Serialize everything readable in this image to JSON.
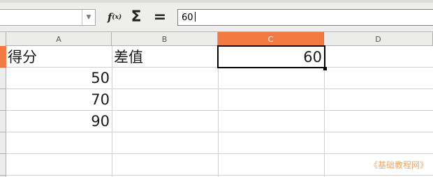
{
  "toolbar": {
    "namebox_value": "",
    "namebox_arrow": "▼",
    "function_wizard_label": "f",
    "function_wizard_sub": "(x)",
    "sum_label": "Σ",
    "formula_label": "=",
    "formula_value": "60"
  },
  "columns": [
    {
      "label": "A",
      "active": false
    },
    {
      "label": "B",
      "active": false
    },
    {
      "label": "C",
      "active": true
    },
    {
      "label": "D",
      "active": false
    }
  ],
  "cells": {
    "A1": "得分",
    "B1": "差值",
    "C1": "60",
    "A2": "50",
    "A3": "70",
    "A4": "90"
  },
  "selected_cell": "C1",
  "watermark": "《基础教程网》",
  "colors": {
    "accent": "#f37b43",
    "toolbar_bg": "#eeeeec",
    "header_bg": "#ececea",
    "watermark": "#f0a766"
  }
}
